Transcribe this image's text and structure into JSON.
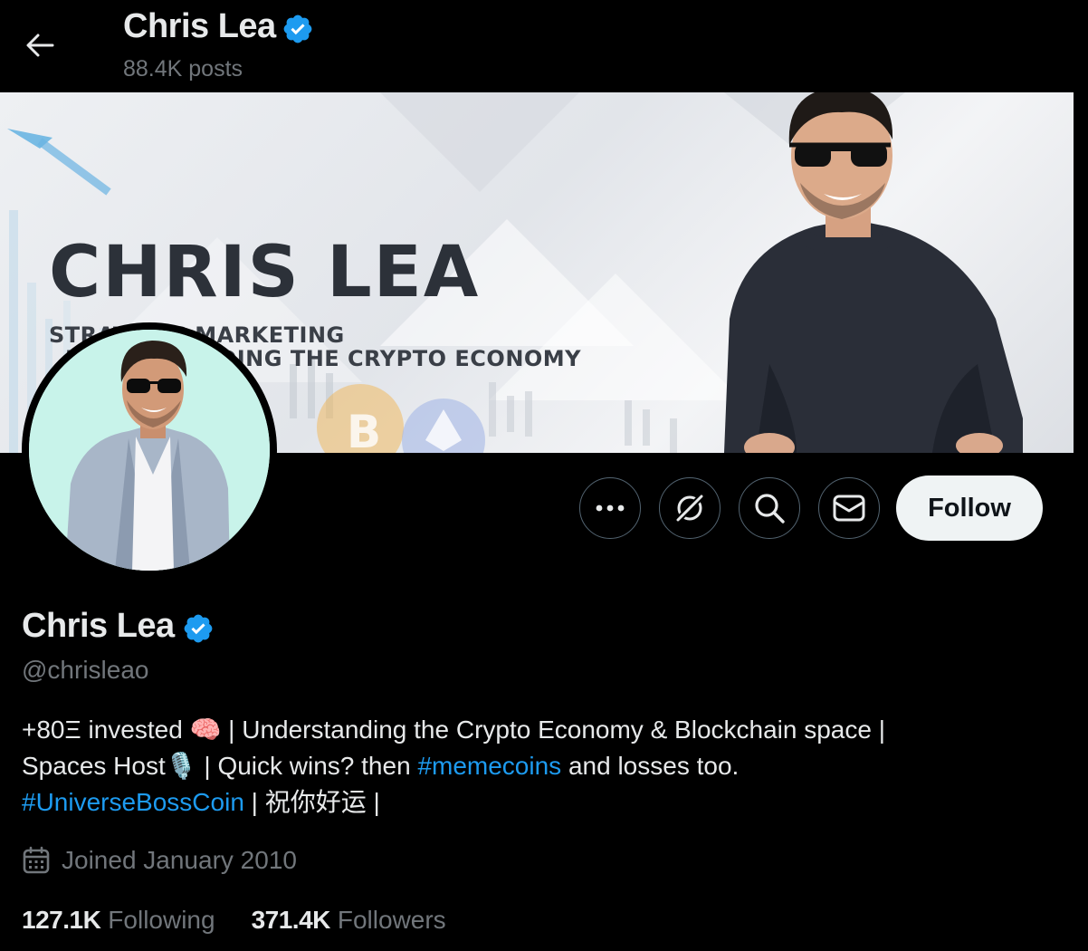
{
  "header": {
    "back_icon": "arrow-left-icon",
    "title": "Chris Lea",
    "posts_count": "88.4K posts",
    "verified_icon": "verified-badge-icon"
  },
  "banner": {
    "headline": "CHRIS LEA",
    "subline_1": "STRATEGIC MARKETING",
    "subline_2": "UNDERSTANDING THE CRYPTO ECONOMY",
    "coin_1": "B"
  },
  "actions": {
    "more_icon": "more-icon",
    "grok_icon": "grok-icon",
    "search_icon": "search-icon",
    "message_icon": "envelope-icon",
    "follow_label": "Follow"
  },
  "profile": {
    "name": "Chris Lea",
    "handle": "@chrisleao",
    "bio": {
      "line1": "+80Ξ invested 🧠 | Understanding the Crypto Economy & Blockchain space |",
      "line2_a": "Spaces Host🎙️ | Quick wins? then ",
      "line2_tag": "#memecoins",
      "line2_b": " and losses too.",
      "line3_tag": "#UniverseBossCoin",
      "line3_b": " | 祝你好运 |"
    },
    "joined": "Joined January 2010",
    "following_count": "127.1K",
    "following_label": "Following",
    "followers_count": "371.4K",
    "followers_label": "Followers"
  },
  "colors": {
    "background": "#000000",
    "accent": "#1d9bf0",
    "text_primary": "#e7e9ea",
    "text_secondary": "#71767b",
    "follow_button": "#eff3f4"
  }
}
